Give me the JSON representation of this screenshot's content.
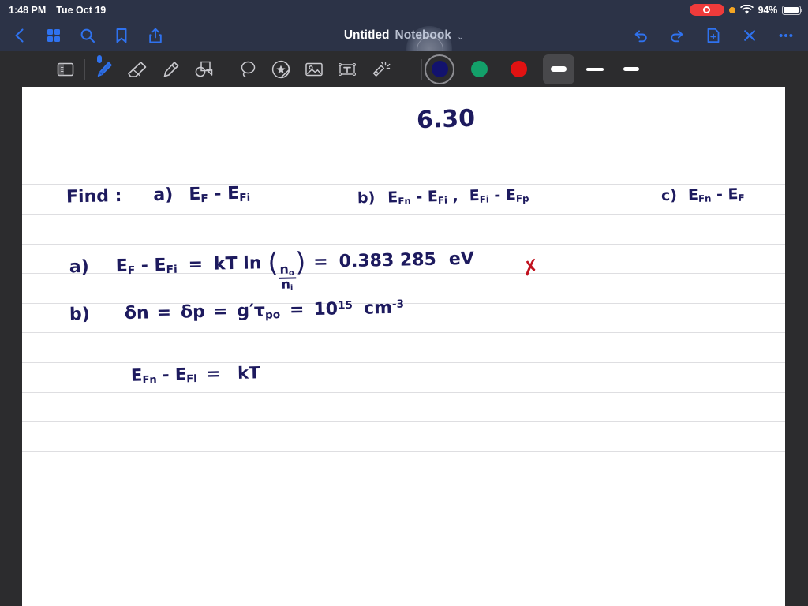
{
  "status_bar": {
    "time": "1:48 PM",
    "date": "Tue Oct 19",
    "battery_percent": "94%",
    "battery_level": 94,
    "recording_indicator": "screen-recording-active",
    "privacy_dot": "microphone-in-use",
    "wifi": "wifi-connected",
    "colors": {
      "bar_bg": "#2c3347",
      "recording": "#ef3b3b",
      "privacy": "#f5a623"
    }
  },
  "nav_bar": {
    "left_icons": [
      {
        "name": "back-icon",
        "glyph": "chevron-left"
      },
      {
        "name": "thumbnails-icon",
        "glyph": "grid"
      },
      {
        "name": "search-icon",
        "glyph": "magnifier"
      },
      {
        "name": "bookmark-icon",
        "glyph": "bookmark"
      },
      {
        "name": "share-icon",
        "glyph": "share-up-arrow"
      }
    ],
    "title_bold": "Untitled",
    "title_light": "Notebook",
    "title_chevron": "⌄",
    "right_icons": [
      {
        "name": "undo-icon",
        "glyph": "undo-arrow"
      },
      {
        "name": "redo-icon",
        "glyph": "redo-arrow"
      },
      {
        "name": "new-page-icon",
        "glyph": "document-plus"
      },
      {
        "name": "close-icon",
        "glyph": "x-mark"
      },
      {
        "name": "more-options-icon",
        "glyph": "ellipsis"
      }
    ],
    "accent_color": "#2f72ef"
  },
  "tool_palette": {
    "tools": [
      {
        "name": "page-layout-tool",
        "label": "Page Layout",
        "selected": false
      },
      {
        "name": "pen-tool",
        "label": "Pen",
        "selected": true
      },
      {
        "name": "eraser-tool",
        "label": "Eraser",
        "selected": false
      },
      {
        "name": "highlighter-tool",
        "label": "Highlighter",
        "selected": false
      },
      {
        "name": "shapes-tool",
        "label": "Shapes",
        "selected": false
      },
      {
        "name": "lasso-tool",
        "label": "Lasso",
        "selected": false
      },
      {
        "name": "sticker-tool",
        "label": "Sticker",
        "selected": false
      },
      {
        "name": "image-tool",
        "label": "Image",
        "selected": false
      },
      {
        "name": "text-box-tool",
        "label": "Text Box",
        "selected": false
      },
      {
        "name": "laser-pointer-tool",
        "label": "Laser Pointer",
        "selected": false
      }
    ],
    "colors": [
      {
        "name": "color-swatch-navy",
        "hex": "#12126e",
        "selected": true
      },
      {
        "name": "color-swatch-green",
        "hex": "#13a06a",
        "selected": false
      },
      {
        "name": "color-swatch-red",
        "hex": "#e11212",
        "selected": false
      }
    ],
    "stroke_widths": [
      {
        "name": "stroke-width-thick",
        "px": 7,
        "selected": true
      },
      {
        "name": "stroke-width-medium",
        "px": 4,
        "selected": false
      },
      {
        "name": "stroke-width-thin",
        "px": 5,
        "selected": false
      }
    ],
    "palette_bg": "#2c2c2e"
  },
  "notebook": {
    "paper_color": "#ffffff",
    "rule_color": "#dedee1",
    "ink_color": "#1d1a5e",
    "correction_color": "#c1121f",
    "heading": "6.30",
    "lines": [
      {
        "name": "find-line",
        "text": "Find :       a)   E_F - E_Fi          b)  E_Fn - E_Fi ,  E_Fi - E_Fp     c)  E_Fn - E_F"
      },
      {
        "name": "part-a-line",
        "text": "a)    E_F - E_Fi  =  kT ln ( n_0 / n_i )  =  0.383 285   eV"
      },
      {
        "name": "part-b-line",
        "text": "b)    δn  =  δp  =  g' τ_po  =  10^15  cm^-3"
      },
      {
        "name": "part-b-line-2",
        "text": "E_Fn - E_Fi  =  kT"
      }
    ],
    "correction_mark": "✗"
  }
}
